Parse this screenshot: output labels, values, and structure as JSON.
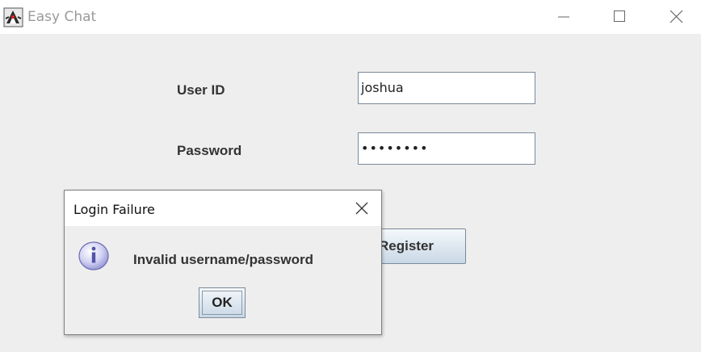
{
  "window": {
    "title": "Easy Chat",
    "icon": "java-duke-icon",
    "controls": [
      "minimize",
      "maximize",
      "close"
    ]
  },
  "form": {
    "user_id_label": "User ID",
    "user_id_value": "joshua",
    "password_label": "Password",
    "password_value": "••••••••",
    "register_label": "Register"
  },
  "dialog": {
    "title": "Login Failure",
    "icon": "info-icon",
    "message": "Invalid username/password",
    "ok_label": "OK"
  },
  "colors": {
    "window_bg": "#eeeeee",
    "titlebar_bg": "#ffffff",
    "title_text": "#9a9a9a",
    "label_text": "#333333",
    "button_gradient_top": "#f4f8fb",
    "button_gradient_bottom": "#c9d8e6",
    "field_border": "#7a8a99",
    "info_icon_fill": "#c7c7f0"
  }
}
